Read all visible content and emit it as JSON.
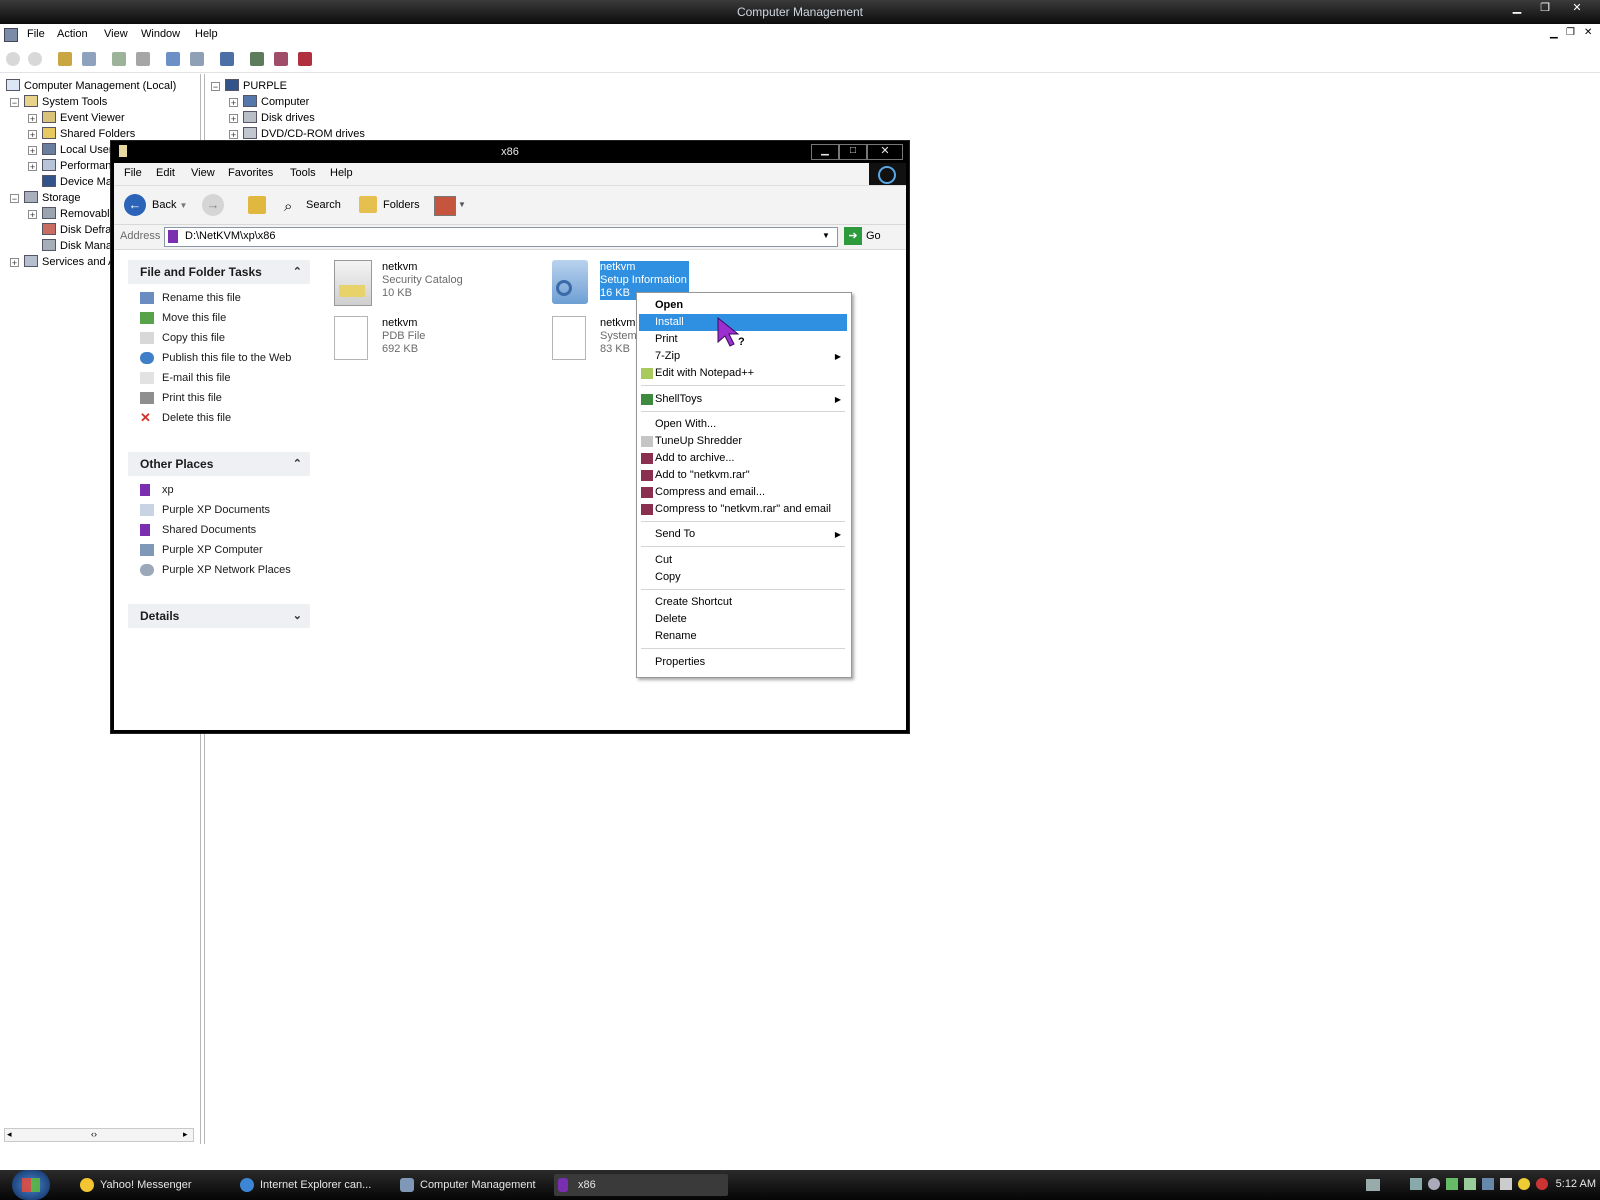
{
  "main_window": {
    "title": "Computer Management",
    "menu": [
      "File",
      "Action",
      "View",
      "Window",
      "Help"
    ],
    "tree": [
      {
        "label": "Computer Management (Local)",
        "level": 0
      },
      {
        "label": "System Tools",
        "level": 1
      },
      {
        "label": "Event Viewer",
        "level": 2
      },
      {
        "label": "Shared Folders",
        "level": 2
      },
      {
        "label": "Local Users and Groups",
        "level": 2
      },
      {
        "label": "Performance Logs and Alerts",
        "level": 2
      },
      {
        "label": "Device Manager",
        "level": 2
      },
      {
        "label": "Storage",
        "level": 1
      },
      {
        "label": "Removable Storage",
        "level": 2
      },
      {
        "label": "Disk Defragmenter",
        "level": 2
      },
      {
        "label": "Disk Management",
        "level": 2
      },
      {
        "label": "Services and Applications",
        "level": 1
      }
    ],
    "device_tree": [
      "PURPLE",
      "Computer",
      "Disk drives",
      "DVD/CD-ROM drives"
    ]
  },
  "explorer": {
    "title": "x86",
    "menu": [
      "File",
      "Edit",
      "View",
      "Favorites",
      "Tools",
      "Help"
    ],
    "toolbar": {
      "back": "Back",
      "search": "Search",
      "folders": "Folders"
    },
    "address_label": "Address",
    "address_value": "D:\\NetKVM\\xp\\x86",
    "go_label": "Go",
    "file_tasks": {
      "title": "File and Folder Tasks",
      "items": [
        "Rename this file",
        "Move this file",
        "Copy this file",
        "Publish this file to the Web",
        "E-mail this file",
        "Print this file",
        "Delete this file"
      ]
    },
    "other_places": {
      "title": "Other Places",
      "items": [
        "xp",
        "Purple XP Documents",
        "Shared Documents",
        "Purple XP Computer",
        "Purple XP Network Places"
      ]
    },
    "details": {
      "title": "Details"
    },
    "files": [
      {
        "name": "netkvm",
        "type": "Security Catalog",
        "size": "10 KB"
      },
      {
        "name": "netkvm",
        "type": "Setup Information",
        "size": "16 KB"
      },
      {
        "name": "netkvm",
        "type": "PDB File",
        "size": "692 KB"
      },
      {
        "name": "netkvm",
        "type": "System",
        "size": "83 KB"
      }
    ]
  },
  "context_menu": {
    "items": [
      "Open",
      "Install",
      "Print",
      "7-Zip",
      "Edit with Notepad++",
      "ShellToys",
      "Open With...",
      "TuneUp Shredder",
      "Add to archive...",
      "Add to \"netkvm.rar\"",
      "Compress and email...",
      "Compress to \"netkvm.rar\" and email",
      "Send To",
      "Cut",
      "Copy",
      "Create Shortcut",
      "Delete",
      "Rename",
      "Properties"
    ]
  },
  "cursor_hint": "?",
  "taskbar": {
    "tasks": [
      "Yahoo! Messenger",
      "Internet Explorer can...",
      "Computer Management",
      "x86"
    ],
    "clock": "5:12 AM"
  },
  "colors": {
    "highlight": "#2f8fe0",
    "titlebar": "#0c0c0c",
    "taskpane_header": "#eef0f4"
  }
}
